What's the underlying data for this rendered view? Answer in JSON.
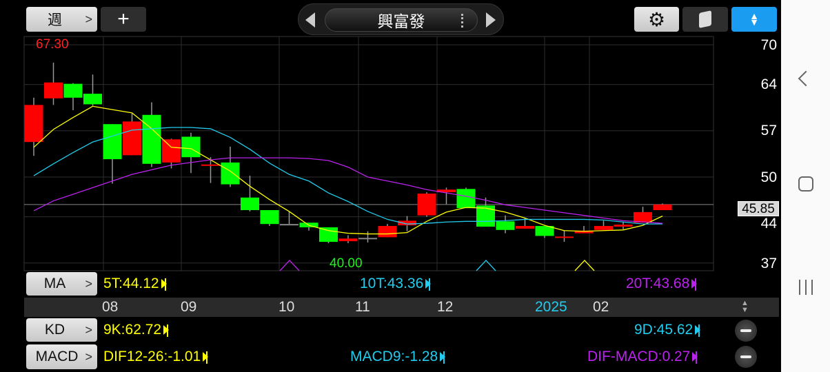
{
  "topbar": {
    "period_label": "週",
    "add_label": "+",
    "stock_name": "興富發"
  },
  "colors": {
    "up": "#ff0000",
    "down": "#00ff00",
    "ma5": "#ffff00",
    "ma10": "#22ccee",
    "ma20": "#bb22ee",
    "accent": "#1a9cf0"
  },
  "price_labels": {
    "high": "67.30",
    "low": "40.00",
    "current": "45.85"
  },
  "y_ticks": [
    "70",
    "64",
    "57",
    "50",
    "44",
    "37"
  ],
  "month_labels": [
    {
      "text": "08"
    },
    {
      "text": "09"
    },
    {
      "text": "10"
    },
    {
      "text": "11"
    },
    {
      "text": "12"
    },
    {
      "text": "2025"
    },
    {
      "text": "02"
    }
  ],
  "ma_row": {
    "button": "MA",
    "ma5": "5T:44.12",
    "ma10": "10T:43.36",
    "ma20": "20T:43.68"
  },
  "kd_row": {
    "button": "KD",
    "k": "9K:62.72",
    "d": "9D:45.62"
  },
  "macd_row": {
    "button": "MACD",
    "dif": "DIF12-26:-1.01",
    "macd": "MACD9:-1.28",
    "osc": "DIF-MACD:0.27"
  },
  "chart_data": {
    "type": "candlestick",
    "title": "興富發",
    "period": "weekly",
    "ylim": [
      36.5,
      71
    ],
    "y_ticks": [
      70,
      64,
      57,
      50,
      44,
      37
    ],
    "x_tick_labels": [
      "08",
      "09",
      "10",
      "11",
      "12",
      "2025",
      "02"
    ],
    "current_price": 45.85,
    "high_label": 67.3,
    "low_label": 40.0,
    "candles": [
      [
        55.3,
        60.9,
        62.0,
        53.2
      ],
      [
        61.9,
        64.3,
        67.3,
        60.9
      ],
      [
        64.1,
        62.0,
        64.2,
        60.1
      ],
      [
        62.6,
        61.0,
        65.5,
        60.8
      ],
      [
        58.0,
        52.7,
        58.0,
        49.0
      ],
      [
        53.3,
        58.4,
        59.6,
        53.3
      ],
      [
        59.4,
        52.0,
        61.3,
        51.5
      ],
      [
        52.2,
        55.7,
        55.8,
        51.3
      ],
      [
        56.1,
        53.0,
        56.7,
        50.6
      ],
      [
        51.7,
        51.9,
        53.0,
        49.1
      ],
      [
        52.2,
        48.9,
        54.6,
        48.5
      ],
      [
        46.9,
        45.0,
        50.2,
        44.8
      ],
      [
        45.0,
        42.9,
        45.0,
        42.6
      ],
      [
        42.9,
        42.9,
        44.8,
        42.9
      ],
      [
        43.1,
        42.4,
        43.1,
        41.9
      ],
      [
        42.4,
        40.2,
        42.4,
        40.0
      ],
      [
        40.3,
        40.7,
        41.2,
        40.0
      ],
      [
        40.8,
        40.8,
        41.8,
        40.1
      ],
      [
        40.9,
        42.6,
        42.9,
        40.9
      ],
      [
        42.7,
        43.4,
        44.1,
        41.8
      ],
      [
        44.2,
        47.5,
        47.7,
        44.0
      ],
      [
        47.7,
        48.1,
        48.4,
        45.9
      ],
      [
        48.2,
        45.3,
        48.4,
        45.3
      ],
      [
        45.7,
        42.5,
        46.9,
        42.5
      ],
      [
        43.3,
        42.0,
        44.2,
        41.5
      ],
      [
        42.2,
        42.6,
        43.8,
        42.2
      ],
      [
        42.6,
        41.1,
        42.6,
        40.8
      ],
      [
        40.9,
        41.0,
        41.9,
        40.2
      ],
      [
        41.5,
        41.9,
        42.6,
        41.5
      ],
      [
        42.0,
        42.6,
        43.4,
        42.0
      ],
      [
        42.5,
        42.8,
        43.2,
        42.1
      ],
      [
        43.1,
        44.7,
        45.5,
        43.1
      ],
      [
        45.0,
        45.85,
        46.0,
        45.0
      ]
    ],
    "series": [
      {
        "name": "5T",
        "values": [
          54.5,
          57.2,
          59.0,
          60.7,
          60.2,
          59.7,
          57.3,
          54.5,
          54.3,
          52.6,
          50.9,
          48.6,
          46.6,
          44.8,
          42.7,
          41.9,
          41.5,
          41.4,
          41.4,
          41.6,
          43.3,
          44.7,
          45.4,
          45.3,
          44.7,
          43.8,
          42.7,
          41.9,
          41.8,
          41.9,
          42.0,
          42.7,
          44.1
        ]
      },
      {
        "name": "10T",
        "values": [
          50.2,
          52.0,
          53.7,
          55.3,
          56.2,
          57.1,
          57.3,
          57.5,
          57.5,
          57.3,
          56.0,
          54.2,
          52.1,
          50.4,
          49.4,
          47.6,
          46.3,
          44.8,
          43.6,
          42.9,
          43.0,
          43.2,
          43.3,
          43.3,
          43.4,
          43.6,
          43.6,
          43.6,
          43.6,
          43.5,
          43.2,
          42.9,
          42.9
        ]
      },
      {
        "name": "20T",
        "values": [
          44.9,
          46.4,
          47.4,
          48.4,
          49.4,
          50.4,
          51.1,
          51.8,
          52.2,
          52.6,
          52.9,
          52.9,
          52.9,
          52.9,
          52.8,
          52.5,
          51.5,
          50.0,
          49.4,
          48.8,
          48.1,
          47.6,
          47.1,
          46.5,
          45.8,
          45.4,
          45.0,
          44.6,
          44.2,
          43.8,
          43.4,
          43.2,
          43.0
        ]
      }
    ]
  }
}
